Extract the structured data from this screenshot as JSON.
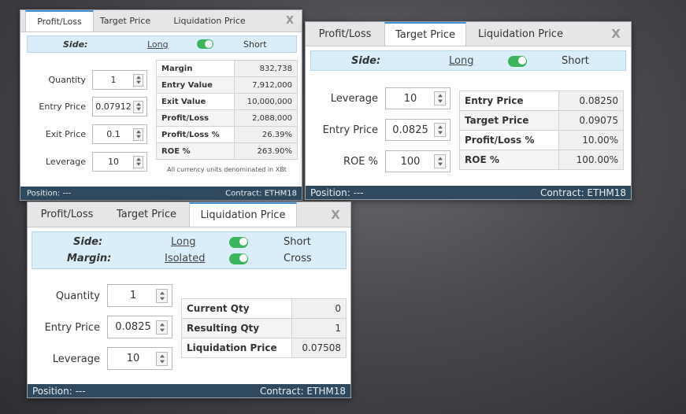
{
  "panel1": {
    "tabs": [
      "Profit/Loss",
      "Target Price",
      "Liquidation Price"
    ],
    "close": "X",
    "side": {
      "label": "Side:",
      "long": "Long",
      "short": "Short"
    },
    "fields": [
      {
        "label": "Quantity",
        "value": "1"
      },
      {
        "label": "Entry Price",
        "value": "0.07912"
      },
      {
        "label": "Exit Price",
        "value": "0.1"
      },
      {
        "label": "Leverage",
        "value": "10"
      }
    ],
    "results": [
      {
        "key": "Margin",
        "value": "832,738"
      },
      {
        "key": "Entry Value",
        "value": "7,912,000"
      },
      {
        "key": "Exit Value",
        "value": "10,000,000"
      },
      {
        "key": "Profit/Loss",
        "value": "2,088,000"
      },
      {
        "key": "Profit/Loss %",
        "value": "26.39%"
      },
      {
        "key": "ROE %",
        "value": "263.90%"
      }
    ],
    "note": "All currency units denominated in XBt",
    "footer": {
      "position": "Position: ---",
      "contract": "Contract: ETHM18"
    }
  },
  "panel2": {
    "tabs": [
      "Profit/Loss",
      "Target Price",
      "Liquidation Price"
    ],
    "close": "X",
    "side": {
      "label": "Side:",
      "long": "Long",
      "short": "Short"
    },
    "fields": [
      {
        "label": "Leverage",
        "value": "10"
      },
      {
        "label": "Entry Price",
        "value": "0.0825"
      },
      {
        "label": "ROE %",
        "value": "100"
      }
    ],
    "results": [
      {
        "key": "Entry Price",
        "value": "0.08250"
      },
      {
        "key": "Target Price",
        "value": "0.09075"
      },
      {
        "key": "Profit/Loss %",
        "value": "10.00%"
      },
      {
        "key": "ROE %",
        "value": "100.00%"
      }
    ],
    "footer": {
      "position": "Position: ---",
      "contract": "Contract: ETHM18"
    }
  },
  "panel3": {
    "tabs": [
      "Profit/Loss",
      "Target Price",
      "Liquidation Price"
    ],
    "close": "X",
    "side": {
      "label": "Side:",
      "long": "Long",
      "short": "Short"
    },
    "margin": {
      "label": "Margin:",
      "isolated": "Isolated",
      "cross": "Cross"
    },
    "fields": [
      {
        "label": "Quantity",
        "value": "1"
      },
      {
        "label": "Entry Price",
        "value": "0.0825"
      },
      {
        "label": "Leverage",
        "value": "10"
      }
    ],
    "results": [
      {
        "key": "Current Qty",
        "value": "0"
      },
      {
        "key": "Resulting Qty",
        "value": "1"
      },
      {
        "key": "Liquidation Price",
        "value": "0.07508"
      }
    ],
    "footer": {
      "position": "Position: ---",
      "contract": "Contract: ETHM18"
    }
  },
  "colors": {
    "accent": "#3d8fd1",
    "toggle": "#3db55e",
    "footer": "#2f4a5e",
    "side_bg": "#d9eef8"
  }
}
